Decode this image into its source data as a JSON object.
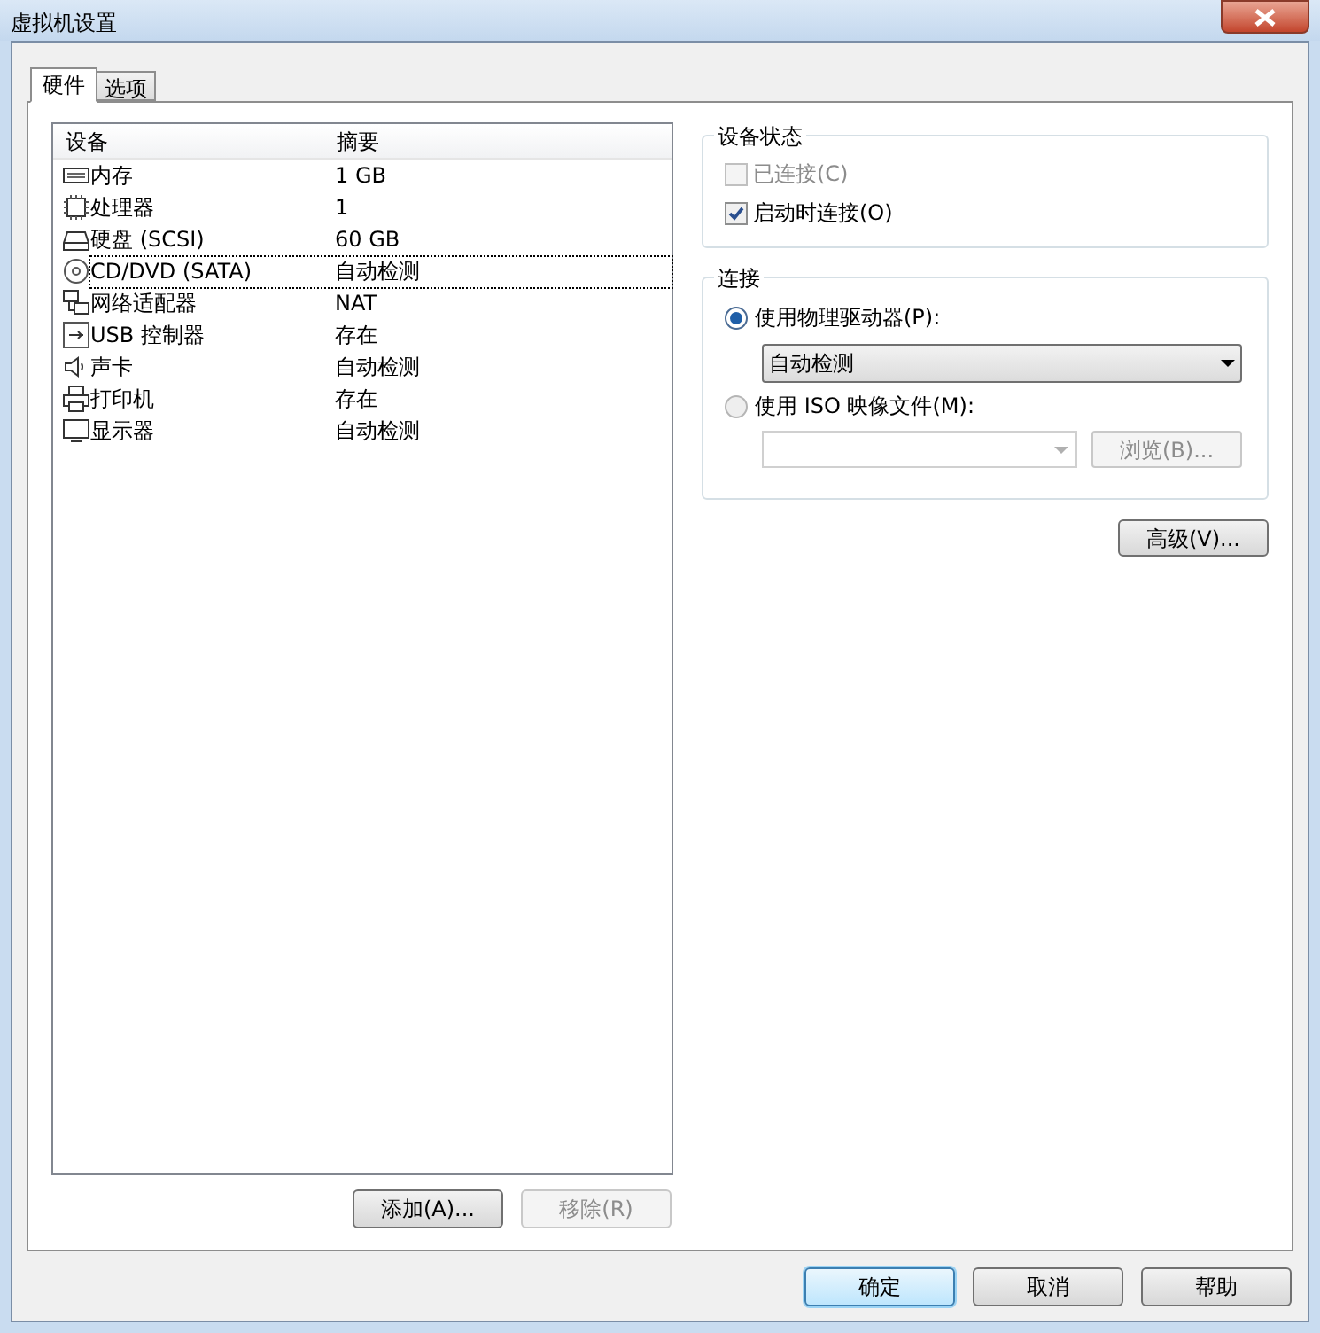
{
  "window": {
    "title": "虚拟机设置"
  },
  "tabs": [
    {
      "label": "硬件",
      "selected": true
    },
    {
      "label": "选项",
      "selected": false
    }
  ],
  "device_list": {
    "columns": [
      "设备",
      "摘要"
    ],
    "rows": [
      {
        "kind": "memory",
        "device": "内存",
        "summary": "1 GB",
        "selected": false
      },
      {
        "kind": "cpu",
        "device": "处理器",
        "summary": "1",
        "selected": false
      },
      {
        "kind": "disk",
        "device": "硬盘 (SCSI)",
        "summary": "60 GB",
        "selected": false
      },
      {
        "kind": "cd",
        "device": "CD/DVD (SATA)",
        "summary": "自动检测",
        "selected": true
      },
      {
        "kind": "network",
        "device": "网络适配器",
        "summary": "NAT",
        "selected": false
      },
      {
        "kind": "usb",
        "device": "USB 控制器",
        "summary": "存在",
        "selected": false
      },
      {
        "kind": "sound",
        "device": "声卡",
        "summary": "自动检测",
        "selected": false
      },
      {
        "kind": "printer",
        "device": "打印机",
        "summary": "存在",
        "selected": false
      },
      {
        "kind": "display",
        "device": "显示器",
        "summary": "自动检测",
        "selected": false
      }
    ]
  },
  "list_buttons": [
    {
      "label": "添加(A)...",
      "disabled": false
    },
    {
      "label": "移除(R)",
      "disabled": true
    }
  ],
  "device_status": {
    "title": "设备状态",
    "checkboxes": [
      {
        "label": "已连接(C)",
        "checked": false,
        "disabled": true
      },
      {
        "label": "启动时连接(O)",
        "checked": true,
        "disabled": false
      }
    ]
  },
  "connection": {
    "title": "连接",
    "physical": {
      "label": "使用物理驱动器(P):",
      "selected": true,
      "value": "自动检测"
    },
    "iso": {
      "label": "使用 ISO 映像文件(M):",
      "selected": false,
      "browse": "浏览(B)..."
    }
  },
  "advanced_button": "高级(V)...",
  "dialog_buttons": [
    {
      "label": "确定",
      "default": true
    },
    {
      "label": "取消",
      "default": false
    },
    {
      "label": "帮助",
      "default": false
    }
  ]
}
